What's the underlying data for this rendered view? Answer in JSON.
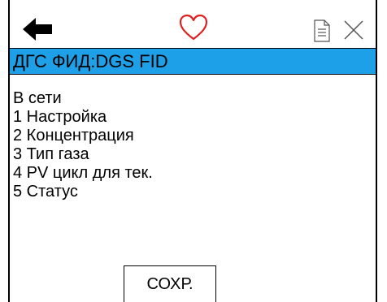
{
  "toolbar": {
    "back_icon": "arrow-left-icon",
    "favorite_icon": "heart-icon",
    "document_icon": "document-icon",
    "close_icon": "close-icon",
    "accent_color": "#e02020"
  },
  "header": {
    "title": "ДГС ФИД:DGS FID",
    "background_color": "#1ea0e8"
  },
  "menu": {
    "status": "В сети",
    "items": [
      "1 Настройка",
      "2 Концентрация",
      "3 Тип газа",
      "4 PV цикл для тек.",
      "5 Статус"
    ]
  },
  "footer": {
    "save_label": "СОХР."
  }
}
